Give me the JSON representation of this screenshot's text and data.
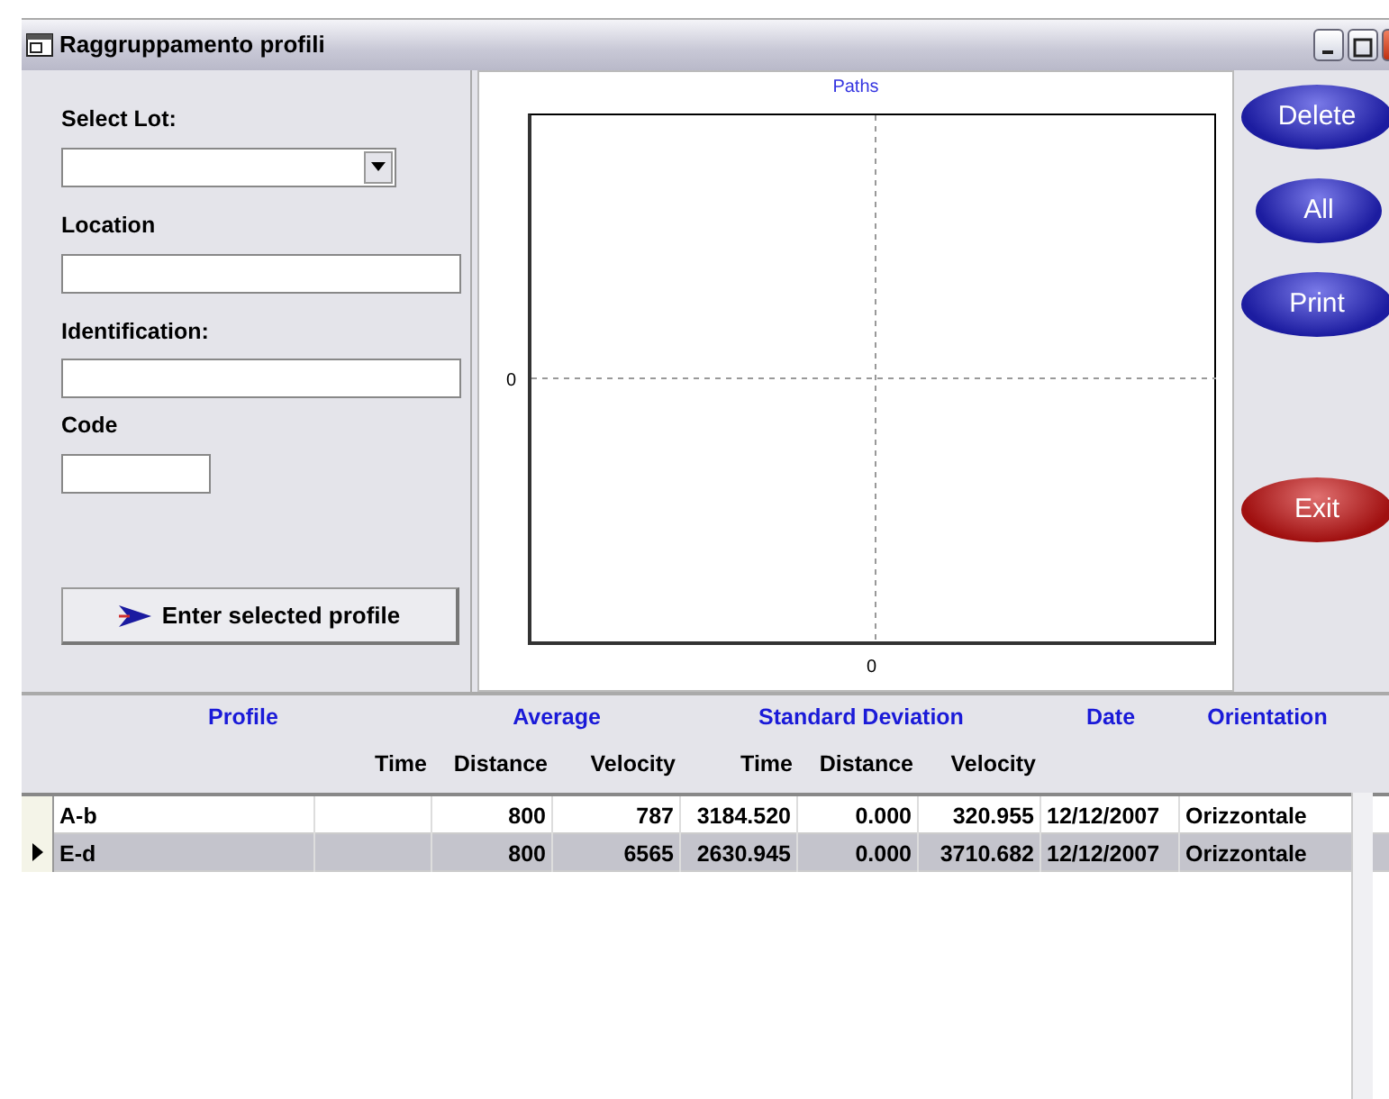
{
  "window": {
    "title": "Raggruppamento profili"
  },
  "form": {
    "select_lot": {
      "label": "Select Lot:"
    },
    "location": {
      "label": "Location"
    },
    "identification": {
      "label": "Identification:"
    },
    "code": {
      "label": "Code"
    },
    "enter_button": "Enter selected profile"
  },
  "chart": {
    "title": "Paths",
    "x_tick": "0",
    "y_tick": "0"
  },
  "buttons": [
    {
      "label": "Delete",
      "kind": "blue"
    },
    {
      "label": "All",
      "kind": "blue"
    },
    {
      "label": "Print",
      "kind": "blue"
    },
    {
      "label": "Exit",
      "kind": "red"
    }
  ],
  "table": {
    "groups": [
      {
        "label": "Profile"
      },
      {
        "label": "Average"
      },
      {
        "label": "Standard Deviation"
      },
      {
        "label": "Date"
      },
      {
        "label": "Orientation"
      }
    ],
    "columns": [
      "",
      "Time",
      "Distance",
      "Velocity",
      "Time",
      "Distance",
      "Velocity",
      "",
      ""
    ],
    "rows": [
      {
        "selected": false,
        "cells": [
          "A-b",
          "",
          "800",
          "787",
          "3184.520",
          "0.000",
          "320.955",
          "12/12/2007",
          "Orizzontale"
        ]
      },
      {
        "selected": true,
        "cells": [
          "E-d",
          "",
          "800",
          "6565",
          "2630.945",
          "0.000",
          "3710.682",
          "12/12/2007",
          "Orizzontale"
        ]
      }
    ]
  }
}
